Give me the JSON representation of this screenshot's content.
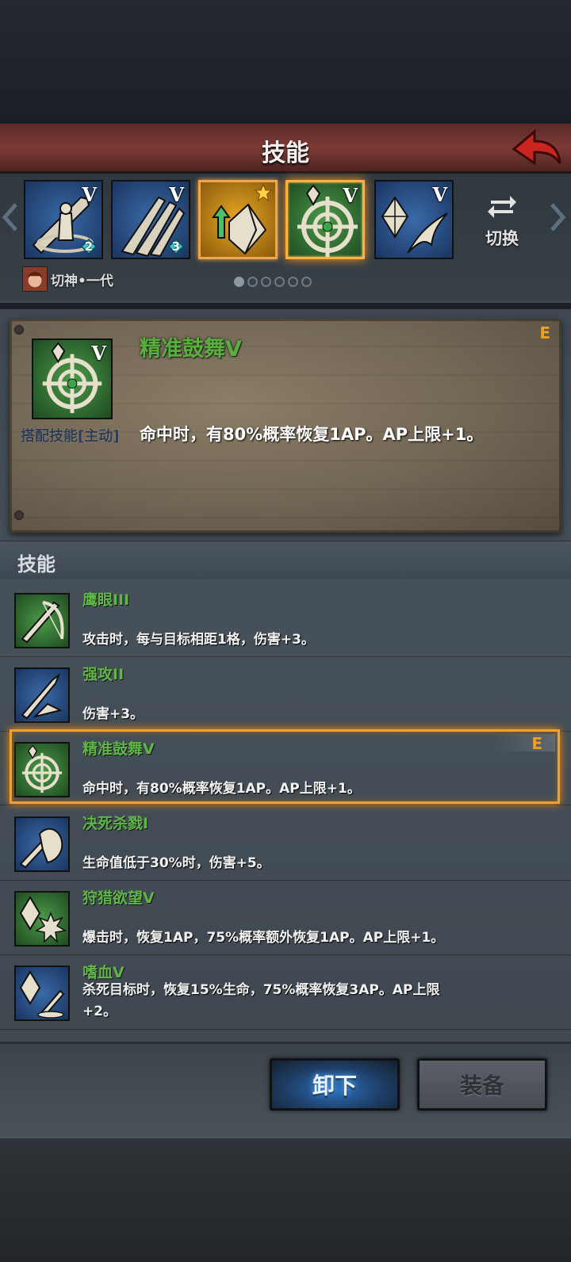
{
  "header": {
    "title": "技能"
  },
  "carousel": {
    "slots": [
      {
        "icon": "sword-shield-icon",
        "level": "V",
        "gem": "2"
      },
      {
        "icon": "claw-slash-icon",
        "level": "V",
        "gem": "3"
      },
      {
        "icon": "shield-break-icon",
        "level": "",
        "gem": ""
      },
      {
        "icon": "crosshair-icon",
        "level": "V",
        "gem": ""
      },
      {
        "icon": "crystal-wing-icon",
        "level": "V",
        "gem": ""
      }
    ],
    "switch_label": "切换",
    "hero_name": "切神•一代",
    "pages": 6,
    "active_page": 1
  },
  "detail": {
    "name": "精准鼓舞V",
    "level": "V",
    "type_label": "搭配技能[主动]",
    "description": "命中时，有80%概率恢复1AP。AP上限+1。",
    "badge": "E"
  },
  "skills_section": {
    "title": "技能"
  },
  "skills": [
    {
      "name": "鹰眼III",
      "desc": "攻击时，每与目标相距1格，伤害+3。",
      "icon": "bow-sword-icon"
    },
    {
      "name": "强攻II",
      "desc": "伤害+3。",
      "icon": "blade-strike-icon"
    },
    {
      "name": "精准鼓舞V",
      "desc": "命中时，有80%概率恢复1AP。AP上限+1。",
      "icon": "crosshair-icon",
      "badge": "E"
    },
    {
      "name": "决死杀戮I",
      "desc": "生命值低于30%时，伤害+5。",
      "icon": "fist-sword-icon"
    },
    {
      "name": "狩猎欲望V",
      "desc": "爆击时，恢复1AP，75%概率额外恢复1AP。AP上限+1。",
      "icon": "crystal-burst-icon"
    },
    {
      "name": "嗜血V",
      "desc": "杀死目标时，恢复15%生命，75%概率恢复3AP。AP上限+2。",
      "icon": "crystal-sword-icon"
    }
  ],
  "buttons": {
    "unequip": "卸下",
    "equip": "装备"
  },
  "colors": {
    "skill_name": "#5fb548",
    "accent": "#f0a030",
    "header": "#7d3a35"
  }
}
